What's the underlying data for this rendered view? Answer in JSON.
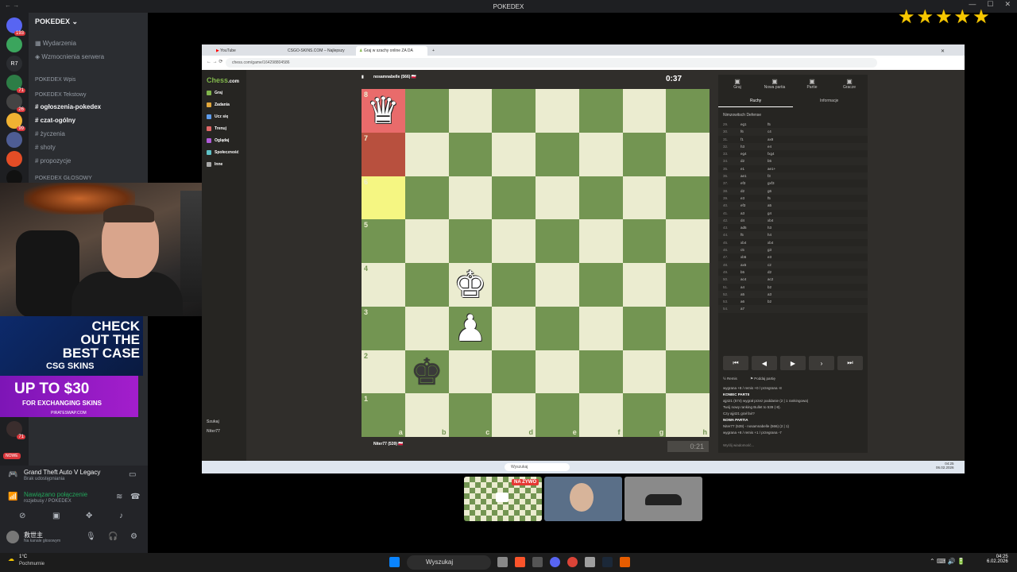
{
  "window": {
    "title": "POKEDEX"
  },
  "stars": [
    "★",
    "★",
    "★",
    "★",
    "★"
  ],
  "server_rail": [
    {
      "badge": "193",
      "color": "#5865f2"
    },
    {
      "badge": "",
      "color": "#3ba55d"
    },
    {
      "badge": "",
      "color": "#2b2d31",
      "text": "R7"
    },
    {
      "badge": "71",
      "color": "#2d7d46"
    },
    {
      "badge": "26",
      "color": "#444"
    },
    {
      "badge": "99",
      "color": "#f0b232"
    },
    {
      "badge": "",
      "color": "#4e5d94"
    },
    {
      "badge": "",
      "color": "#e44d26"
    },
    {
      "badge": "",
      "color": "#111"
    }
  ],
  "discord": {
    "server_name": "POKEDEX",
    "top_items": [
      "Wydarzenia",
      "Wzmocnienia serwera"
    ],
    "cat_wpis": "POKEDEX Wpis",
    "cat_text": "POKEDEX Tekstowy",
    "channels": [
      "ogłoszenia-pokedex",
      "czat-ogólny",
      "życzenia",
      "shoty",
      "propozycje"
    ],
    "cat_voice": "POKEDEX GŁOSOWY",
    "activity_game": "Grand Theft Auto V Legacy",
    "activity_status": "Brak udostępniania",
    "connection": "Nawiązano połączenie",
    "connection_sub": "rozjebusy / POKEDEX",
    "user_name": "救世主",
    "user_status": "Na kanale głosowym",
    "live_badge": "NOWE"
  },
  "ads": {
    "ad1_title": "CHECK OUT THE BEST CASE",
    "ad1_brand": "CSG SKINS",
    "ad2_title": "UP TO $30",
    "ad2_sub": "FOR EXCHANGING SKINS",
    "ad2_brand": "PIRATESWAP.COM"
  },
  "browser": {
    "tabs": [
      "YouTube",
      "CSGO-SKINS.COM – Najlepszy",
      "Graj w szachy online ZA DA"
    ],
    "url": "chess.com/game/164298804586"
  },
  "chess": {
    "logo_a": "Chess",
    "logo_b": ".com",
    "nav": [
      "Graj",
      "Zadania",
      "Ucz się",
      "Trenuj",
      "Oglądaj",
      "Społeczność",
      "Inne"
    ],
    "nav_bottom": [
      "Szukaj",
      "Niter77"
    ],
    "top_player": "nosamnabelle (566) 🇵🇱",
    "bottom_player": "Niter77 (539) 🇵🇱",
    "top_clock": "0:37",
    "bottom_clock": "0:21",
    "ranks": [
      "8",
      "7",
      "6",
      "5",
      "4",
      "3",
      "2",
      "1"
    ],
    "files": [
      "a",
      "b",
      "c",
      "d",
      "e",
      "f",
      "g",
      "h"
    ],
    "pieces": [
      {
        "sq": "a8",
        "glyph": "♛",
        "color": "w"
      },
      {
        "sq": "c4",
        "glyph": "♚",
        "color": "w"
      },
      {
        "sq": "c3",
        "glyph": "♟",
        "color": "w"
      },
      {
        "sq": "b2",
        "glyph": "♚",
        "color": "b"
      }
    ],
    "highlights": [
      {
        "sq": "a8",
        "type": "hr"
      },
      {
        "sq": "a7",
        "type": "hd"
      },
      {
        "sq": "a6",
        "type": "hy"
      }
    ],
    "panel_top": [
      "Graj",
      "Nowa partia",
      "Partie",
      "Gracze"
    ],
    "panel_tabs": [
      "Ruchy",
      "Informacje"
    ],
    "opening": "Nimzowitsch Defense",
    "moves": [
      [
        "29.",
        "eg1",
        "f5"
      ],
      [
        "30.",
        "f6",
        "c4"
      ],
      [
        "31.",
        "f1",
        "ax8"
      ],
      [
        "32.",
        "h3",
        "e4"
      ],
      [
        "33.",
        "eg4",
        "fxg4"
      ],
      [
        "34.",
        "d2",
        "b5"
      ],
      [
        "35.",
        "e1",
        "ae1+"
      ],
      [
        "36.",
        "ae1",
        "f3"
      ],
      [
        "37.",
        "ef3",
        "gxf3"
      ],
      [
        "38.",
        "d2",
        "g6"
      ],
      [
        "39.",
        "e3",
        "f5"
      ],
      [
        "40.",
        "ef3",
        "a5"
      ],
      [
        "41.",
        "a3",
        "g4"
      ],
      [
        "42.",
        "d4",
        "xb4"
      ],
      [
        "43.",
        "ad5",
        "h3"
      ],
      [
        "44.",
        "f5",
        "h4"
      ],
      [
        "45.",
        "xb4",
        "xb4"
      ],
      [
        "46.",
        "c5",
        "g3"
      ],
      [
        "47.",
        "xb5",
        "e3"
      ],
      [
        "48.",
        "ax5",
        "c2"
      ],
      [
        "49.",
        "b5",
        "d2"
      ],
      [
        "50.",
        "ac4",
        "ac2"
      ],
      [
        "51.",
        "a4",
        "b2"
      ],
      [
        "52.",
        "a5",
        "a3"
      ],
      [
        "53.",
        "a6",
        "b2"
      ],
      [
        "54.",
        "a7",
        ""
      ]
    ],
    "panel_actions": [
      "Remis",
      "Poddaj partię"
    ],
    "result_lines": [
      {
        "text": "wygrana +8 / remis +0 / przegrana -8",
        "h": false
      },
      {
        "text": "KONIEC PARTII",
        "h": true
      },
      {
        "text": "ajj421 (574) wygrał przez poddanie (2 | 1 rankingowa)",
        "h": false
      },
      {
        "text": "Twój nowy ranking Bullet to 539 (-8).",
        "h": false
      },
      {
        "text": "Czy ajj421 grał fair?",
        "h": false
      },
      {
        "text": "NOWA PARTIA",
        "h": true
      },
      {
        "text": "Niter77 (539) - nosamnabelle (566) (2 | 1)",
        "h": false
      },
      {
        "text": "wygrana +8 / remis +1 / przegrana -7",
        "h": false
      }
    ],
    "chat_placeholder": "Wyślij wiadomość..."
  },
  "inner_taskbar": {
    "search": "Wyszukaj",
    "time": "04:25",
    "date": "06.02.2026"
  },
  "thumbs": {
    "live_label": "NA ŻYWO"
  },
  "taskbar": {
    "weather_temp": "1°C",
    "weather_desc": "Pochmurnie",
    "search": "Wyszukaj",
    "time": "04:25",
    "date": "6.02.2026"
  }
}
